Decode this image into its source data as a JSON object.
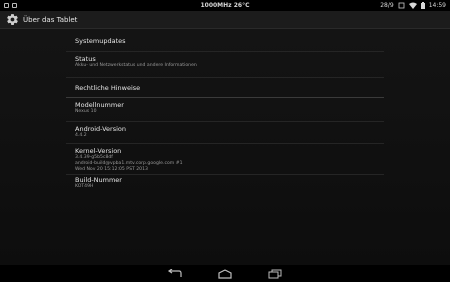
{
  "status_bar": {
    "center_text": "1000MHz 26°C",
    "right_text": "28/9",
    "time": "14:59",
    "icons": [
      "notification-icon",
      "notification-icon-2",
      "battery-indicator-icon",
      "wifi-icon",
      "battery-icon"
    ]
  },
  "action_bar": {
    "title": "Über das Tablet",
    "icon": "gear-icon"
  },
  "items": [
    {
      "title": "Systemupdates",
      "subtitle": ""
    },
    {
      "title": "Status",
      "subtitle": "Akku- und Netzwerkstatus und andere Informationen"
    }
  ],
  "section_header": "Rechtliche Hinweise",
  "info_items": [
    {
      "title": "Modellnummer",
      "lines": [
        "Nexus 10"
      ]
    },
    {
      "title": "Android-Version",
      "lines": [
        "4.4.2"
      ]
    },
    {
      "title": "Kernel-Version",
      "lines": [
        "3.4.39-g5b5c8df",
        "android-build@vpba1.mtv.corp.google.com #1",
        "Wed Nov 20 15:12:05 PST 2013"
      ]
    },
    {
      "title": "Build-Nummer",
      "lines": [
        "KOT49H"
      ]
    }
  ],
  "navigation": {
    "icons": [
      "back-icon",
      "home-icon",
      "recent-apps-icon"
    ]
  }
}
